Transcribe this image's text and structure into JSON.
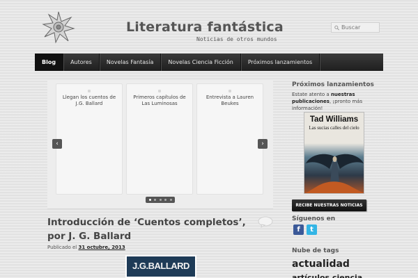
{
  "header": {
    "title": "Literatura fantástica",
    "tagline": "Noticias de otros mundos",
    "search_placeholder": "Buscar"
  },
  "nav": {
    "items": [
      {
        "label": "Blog",
        "active": true
      },
      {
        "label": "Autores"
      },
      {
        "label": "Novelas Fantasía"
      },
      {
        "label": "Novelas Ciencia Ficción"
      },
      {
        "label": "Próximos lanzamientos"
      }
    ]
  },
  "slider": {
    "slides": [
      {
        "title": "Llegan los cuentos de J.G. Ballard"
      },
      {
        "title": "Primeros capítulos de Las Luminosas"
      },
      {
        "title": "Entrevista a Lauren Beukes"
      }
    ],
    "prev_label": "‹",
    "next_label": "›",
    "page_count": 5,
    "current_page": 1
  },
  "post": {
    "title": "Introducción de ‘Cuentos completos’, por J. G. Ballard",
    "meta_prefix": "Publicado el",
    "date": "31 octubre, 2013",
    "thumbnail_text": "J.G.BALLARD"
  },
  "sidebar": {
    "upcoming": {
      "heading": "Próximos lanzamientos",
      "text_before": "Estate atento a ",
      "text_bold": "nuestras publicaciones",
      "text_after": ", ¡pronto más información!",
      "cover_author": "Tad Williams",
      "cover_title": "Las sucias calles del cielo"
    },
    "newsletter_button": "RECIBE NUESTRAS NOTICIAS",
    "follow_heading": "Síguenos en",
    "tags_heading": "Nube de tags",
    "tags": [
      "actualidad",
      "artículos ciencia"
    ]
  },
  "colors": {
    "nav_bg": "#2a2a2a",
    "facebook": "#3b5998",
    "twitter": "#33b5e5",
    "thumb_bg": "#1e3b57"
  }
}
